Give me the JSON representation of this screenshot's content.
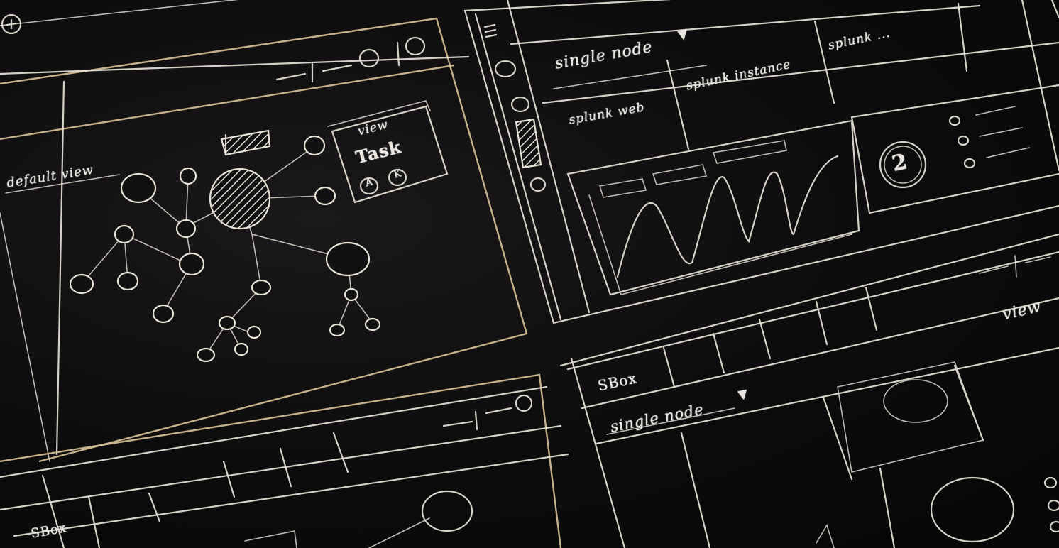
{
  "sketch": {
    "window_1": {
      "sidebar_label": "default view",
      "popup": {
        "title": "view",
        "heading": "Task",
        "buttons": [
          "A",
          "K"
        ]
      }
    },
    "window_2": {
      "dropdown_label": "single node",
      "tabs": [
        "splunk web",
        "splunk instance",
        "splunk ..."
      ],
      "badge": "2"
    },
    "window_3": {
      "tab_label": "SBox",
      "dropdown_label": "single node",
      "corner_label": "view"
    },
    "window_4": {
      "tab_label": "SBox"
    }
  },
  "colors": {
    "chalkboard": "#0c0b0c",
    "chalk": "#e6e2d8",
    "chalk_gold": "#d8c39a"
  }
}
